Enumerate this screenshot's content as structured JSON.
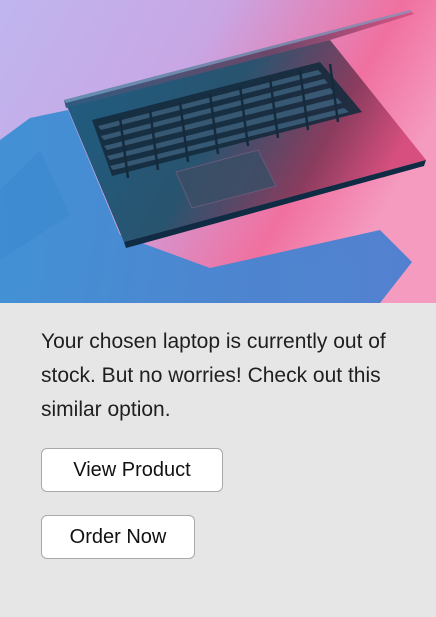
{
  "message": {
    "text": "Your chosen laptop is currently out of stock. But no worries! Check out this similar option."
  },
  "actions": {
    "view_product": "View Product",
    "order_now": "Order Now"
  },
  "colors": {
    "background": "#e6e6e6",
    "button_bg": "#ffffff",
    "button_border": "#a9a9a9",
    "text": "#1f1f1f"
  }
}
